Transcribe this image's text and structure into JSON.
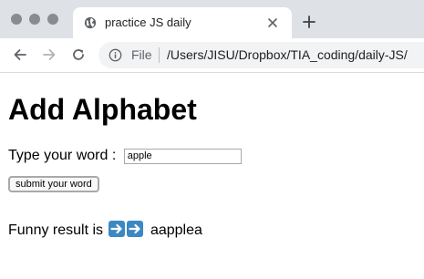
{
  "browser": {
    "tab": {
      "title": "practice JS daily",
      "favicon": "globe-icon",
      "close_icon": "close-icon"
    },
    "new_tab_icon": "plus-icon",
    "nav": {
      "back_icon": "arrow-left-icon",
      "forward_icon": "arrow-right-icon",
      "reload_icon": "reload-icon"
    },
    "omnibox": {
      "info_icon": "info-icon",
      "scheme_label": "File",
      "url": "/Users/JISU/Dropbox/TIA_coding/daily-JS/"
    },
    "colors": {
      "tabstrip": "#dee1e6",
      "traffic_light": "#888b90",
      "omnibox": "#f1f3f4",
      "emoji_blue": "#3b88c3"
    }
  },
  "page": {
    "title": "Add Alphabet",
    "input_label": "Type your word :",
    "input_value": "apple",
    "submit_label": "submit your word",
    "result_prefix": "Funny result is",
    "result_icons": [
      "right-arrow-icon",
      "right-arrow-icon"
    ],
    "result_value": "aapplea"
  }
}
